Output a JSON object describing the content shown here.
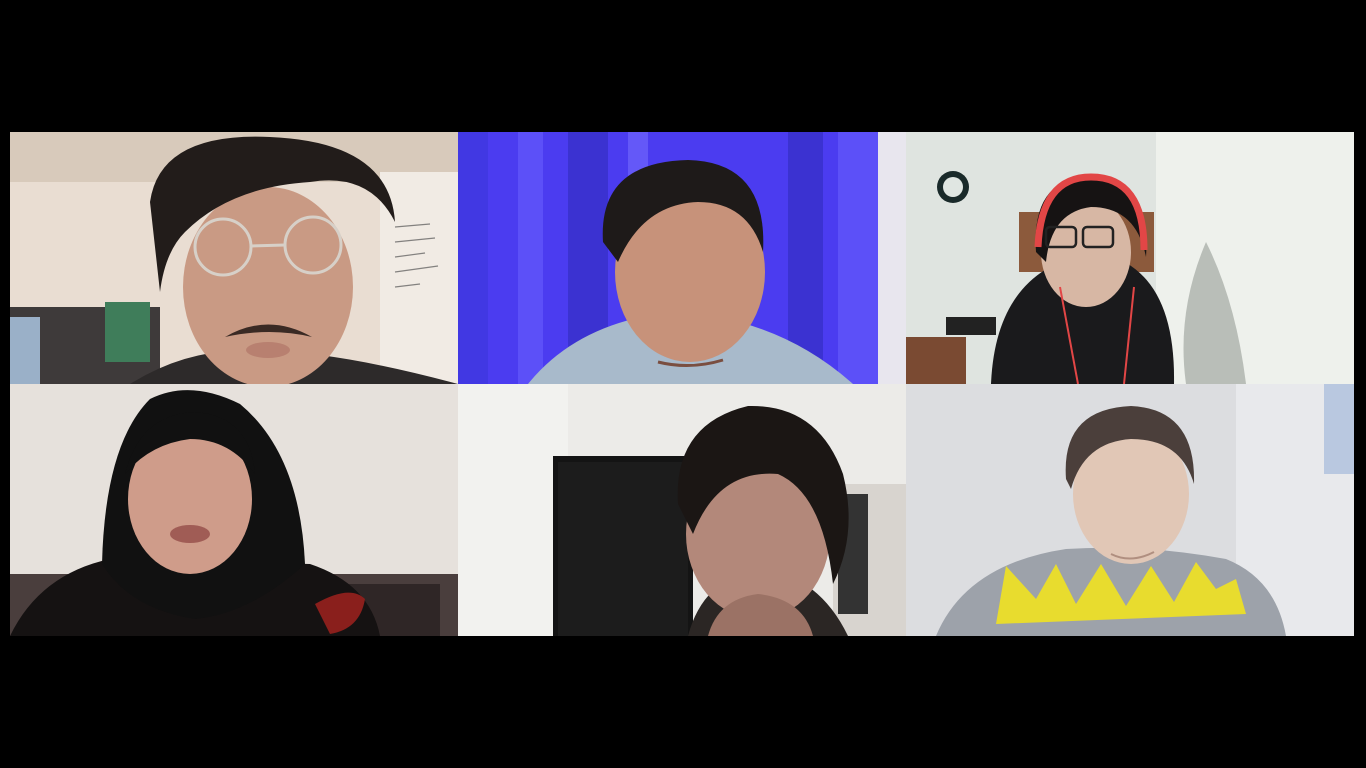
{
  "meeting": {
    "layout": "gallery-3x2",
    "participant_count": 6
  },
  "participants": [
    {
      "id": "p1",
      "video": "on",
      "description_tag": "man-with-glasses-mustache",
      "bg": "#e9ddd2"
    },
    {
      "id": "p2",
      "video": "on",
      "description_tag": "man-blue-curtain",
      "bg": "#4b3cf0"
    },
    {
      "id": "p3",
      "video": "on",
      "description_tag": "woman-red-headphones",
      "bg": "#dfe4e0"
    },
    {
      "id": "p4",
      "video": "on",
      "description_tag": "woman-black-hijab",
      "bg": "#e6e1dc"
    },
    {
      "id": "p5",
      "video": "on",
      "description_tag": "man-hand-on-chin",
      "bg": "#ecebe8"
    },
    {
      "id": "p6",
      "video": "on",
      "description_tag": "man-yellow-shirt",
      "bg": "#dcdde0"
    }
  ]
}
